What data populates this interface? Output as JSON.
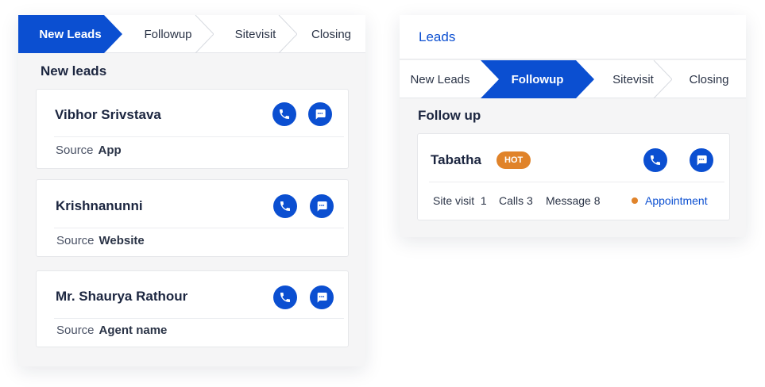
{
  "left_panel": {
    "steps": [
      {
        "label": "New Leads",
        "active": true
      },
      {
        "label": "Followup",
        "active": false
      },
      {
        "label": "Sitevisit",
        "active": false
      },
      {
        "label": "Closing",
        "active": false
      }
    ],
    "section_title": "New leads",
    "leads": [
      {
        "name": "Vibhor Srivstava",
        "source_label": "Source",
        "source_value": "App"
      },
      {
        "name": "Krishnanunni",
        "source_label": "Source",
        "source_value": "Website"
      },
      {
        "name": "Mr. Shaurya Rathour",
        "source_label": "Source",
        "source_value": "Agent name"
      }
    ]
  },
  "right_panel": {
    "header_title": "Leads",
    "steps": [
      {
        "label": "New Leads",
        "active": false
      },
      {
        "label": "Followup",
        "active": true
      },
      {
        "label": "Sitevisit",
        "active": false
      },
      {
        "label": "Closing",
        "active": false
      }
    ],
    "section_title": "Follow up",
    "lead": {
      "name": "Tabatha",
      "badge": "HOT",
      "site_visit": "Site visit  1",
      "calls": "Calls 3",
      "message": "Message 8",
      "appointment": "Appointment"
    }
  },
  "colors": {
    "accent": "#0b4fd1",
    "hot": "#e0832a",
    "panel_bg": "#f5f5f6"
  },
  "icons": [
    "phone-icon",
    "chat-icon",
    "chevron-step-icon"
  ]
}
